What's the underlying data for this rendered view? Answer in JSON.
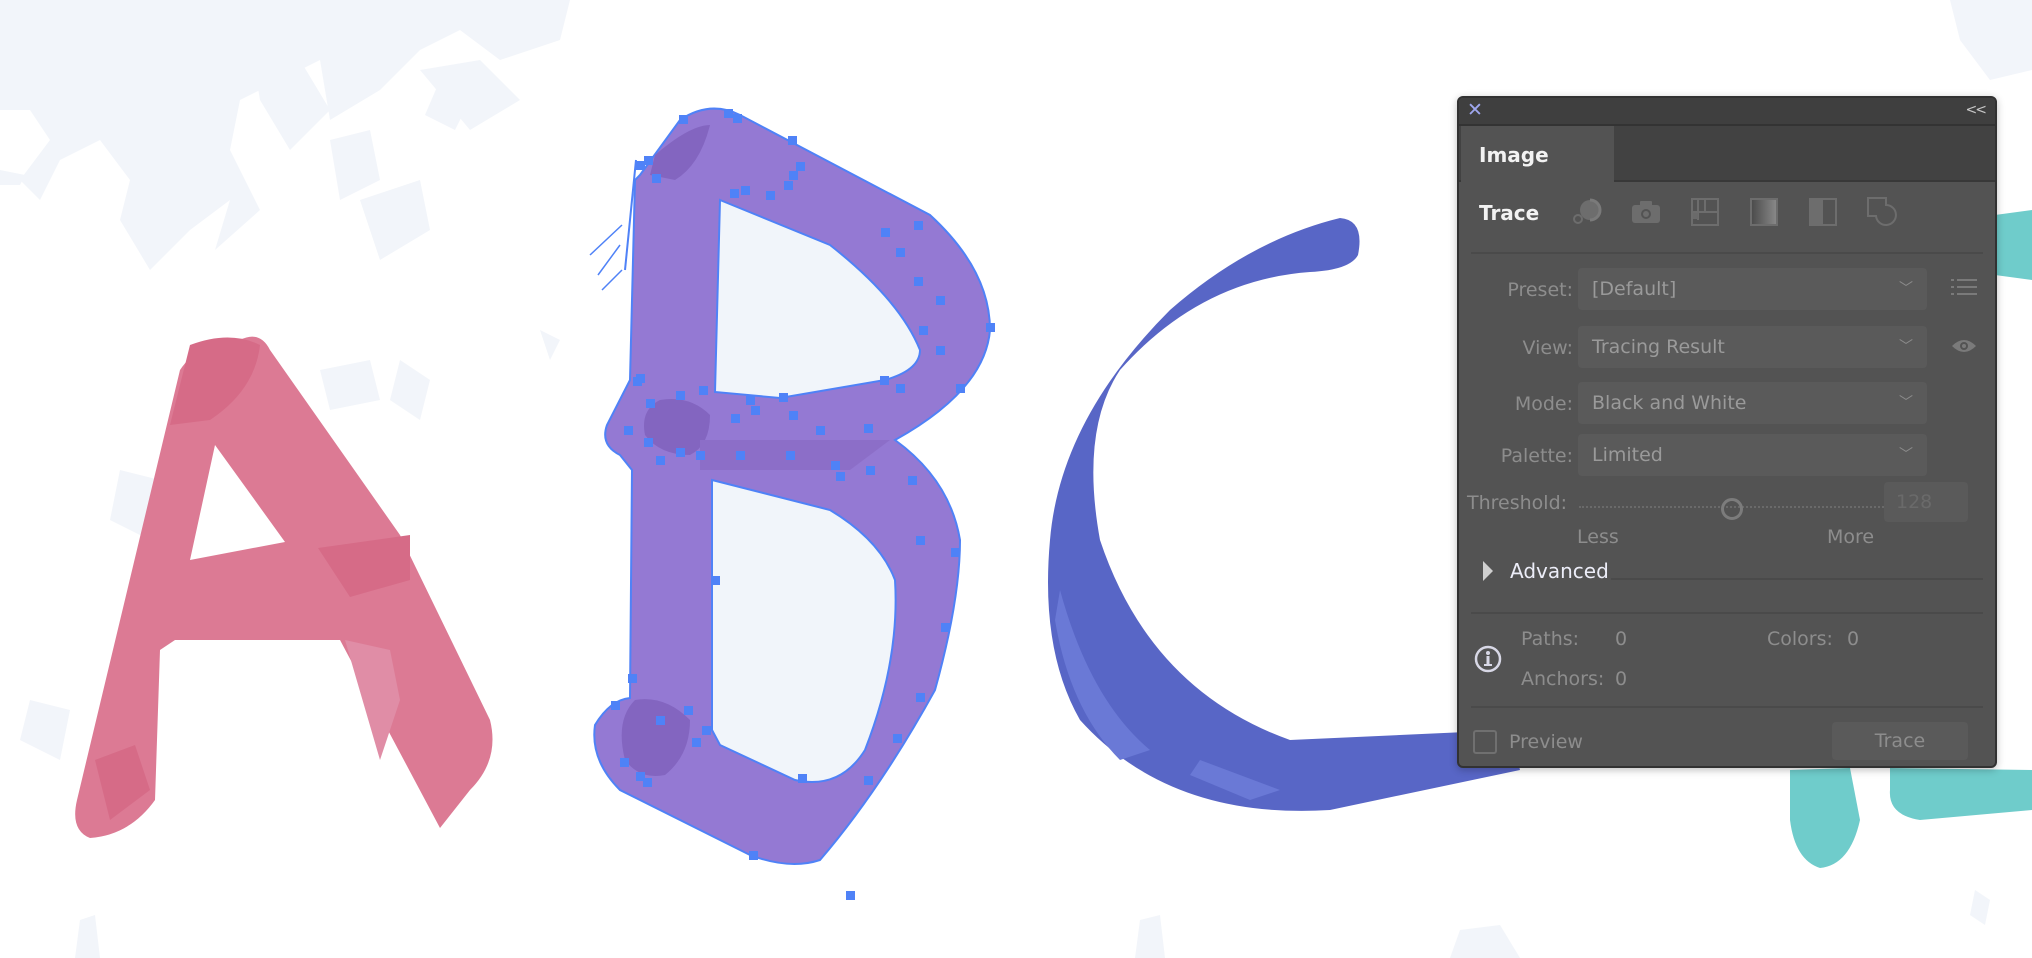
{
  "canvas": {
    "letters": [
      "A",
      "B",
      "C"
    ],
    "colors": {
      "background": "#ffffff",
      "splotch": "#f2f5fa",
      "letter_a": "#dc7a94",
      "letter_a_dark": "#d66b87",
      "letter_b": "#9479d3",
      "letter_b_dark": "#8365c0",
      "letter_b_hole": "#f1f5fa",
      "letter_c": "#5866c6",
      "letter_c_light": "#6a79d6",
      "letter_d_teal": "#6fcccb",
      "selection": "#4f82f7"
    }
  },
  "panel": {
    "title": "Image Trace",
    "close_icon": "close-icon",
    "collapse_label": "<<",
    "preset_icons": [
      {
        "name": "auto-color-icon",
        "label": "Auto-Color"
      },
      {
        "name": "high-color-icon",
        "label": "High Color"
      },
      {
        "name": "low-color-icon",
        "label": "Low Color"
      },
      {
        "name": "grayscale-icon",
        "label": "Grayscale"
      },
      {
        "name": "black-and-white-icon",
        "label": "Black and White"
      },
      {
        "name": "outline-icon",
        "label": "Outline"
      }
    ],
    "preset": {
      "label": "Preset:",
      "value": "[Default]"
    },
    "view": {
      "label": "View:",
      "value": "Tracing Result"
    },
    "mode": {
      "label": "Mode:",
      "value": "Black and White"
    },
    "palette": {
      "label": "Palette:",
      "value": "Limited"
    },
    "threshold": {
      "label": "Threshold:",
      "value": "128",
      "min": 1,
      "max": 255,
      "less_label": "Less",
      "more_label": "More"
    },
    "advanced_label": "Advanced",
    "stats": {
      "paths_label": "Paths:",
      "paths_value": "0",
      "colors_label": "Colors:",
      "colors_value": "0",
      "anchors_label": "Anchors:",
      "anchors_value": "0"
    },
    "preview_label": "Preview",
    "preview_checked": false,
    "trace_label": "Trace"
  }
}
